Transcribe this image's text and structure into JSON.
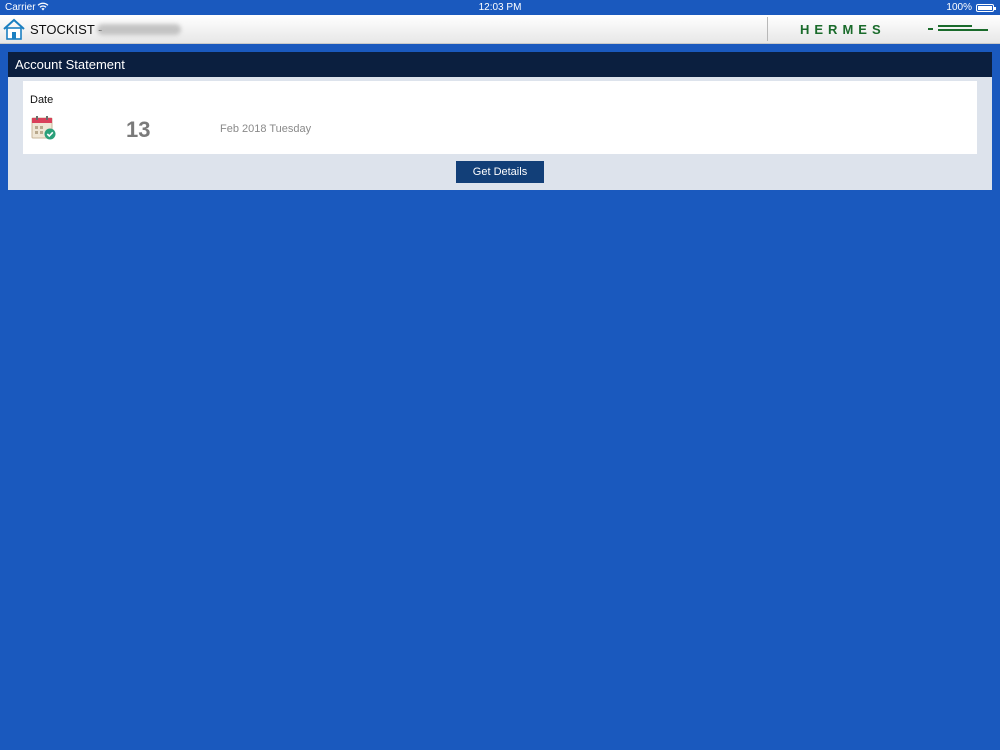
{
  "status_bar": {
    "carrier": "Carrier",
    "time": "12:03 PM",
    "battery": "100%"
  },
  "nav": {
    "title": "STOCKIST -",
    "logo_text": "HERMES"
  },
  "statement": {
    "title": "Account Statement",
    "date_label": "Date",
    "day": "13",
    "month_year_weekday": "Feb 2018 Tuesday",
    "button_label": "Get Details"
  },
  "colors": {
    "background": "#1a59be",
    "header_bar": "#0b1f3f",
    "button": "#123f78",
    "logo": "#1a6b2b"
  },
  "icons": {
    "home": "home-icon",
    "calendar": "calendar-icon",
    "wifi": "wifi-icon",
    "battery": "battery-icon"
  }
}
